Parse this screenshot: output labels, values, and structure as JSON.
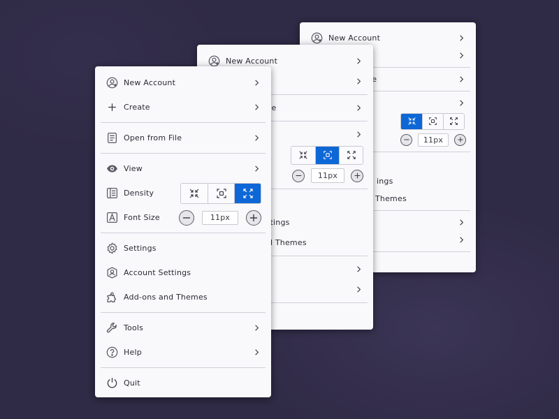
{
  "menu": {
    "new_account": "New Account",
    "create": "Create",
    "open_from_file": "Open from File",
    "view": "View",
    "density": "Density",
    "font_size": "Font Size",
    "font_size_value": "11px",
    "settings": "Settings",
    "account_settings": "Account Settings",
    "addons": "Add-ons and Themes",
    "tools": "Tools",
    "help": "Help",
    "quit": "Quit",
    "density_options": [
      "compact",
      "normal",
      "touch"
    ],
    "density_selected": "touch"
  },
  "back_panel_1": {
    "new_account": "New Account",
    "open_from_file_partial": "ile",
    "font_size_value": "11px",
    "account_settings_partial": "ttings",
    "addons_partial": "d Themes",
    "density_selected": "normal"
  },
  "back_panel_2": {
    "new_account": "New Account",
    "open_from_file_partial": "le",
    "font_size_value": "11px",
    "account_settings_partial": "ings",
    "addons_partial": "Themes",
    "density_selected": "compact"
  },
  "colors": {
    "accent": "#0e67d6",
    "background": "#2f2a45",
    "panel": "#f9f9fb",
    "icon": "#5b5b66"
  }
}
